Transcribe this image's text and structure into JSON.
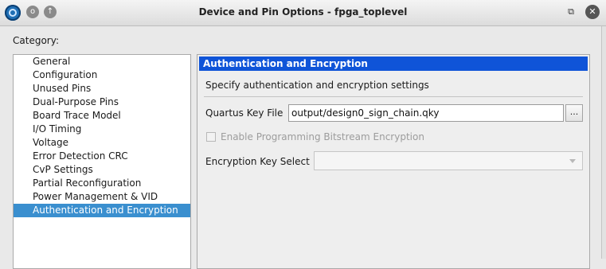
{
  "window": {
    "title": "Device and Pin Options - fpga_toplevel",
    "app_icon": "app-logo-icon",
    "buttons": {
      "circle_label": "o",
      "up_label": "↑",
      "restore_label": "⧉",
      "close_label": "✕"
    }
  },
  "category": {
    "label": "Category:",
    "items": [
      {
        "label": "General"
      },
      {
        "label": "Configuration"
      },
      {
        "label": "Unused Pins"
      },
      {
        "label": "Dual-Purpose Pins"
      },
      {
        "label": "Board Trace Model"
      },
      {
        "label": "I/O Timing"
      },
      {
        "label": "Voltage"
      },
      {
        "label": "Error Detection CRC"
      },
      {
        "label": "CvP Settings"
      },
      {
        "label": "Partial Reconfiguration"
      },
      {
        "label": "Power Management & VID"
      },
      {
        "label": "Authentication and Encryption",
        "selected": true
      }
    ]
  },
  "panel": {
    "header": "Authentication and Encryption",
    "description": "Specify authentication and encryption settings",
    "key_file": {
      "label": "Quartus Key File",
      "value": "output/design0_sign_chain.qky",
      "browse_label": "..."
    },
    "encryption_checkbox": {
      "label": "Enable Programming Bitstream Encryption",
      "checked": false,
      "enabled": false
    },
    "encryption_key_select": {
      "label": "Encryption Key Select",
      "value": ""
    }
  },
  "colors": {
    "header_bg": "#0f54d8",
    "selected_bg": "#3a8fcf"
  }
}
